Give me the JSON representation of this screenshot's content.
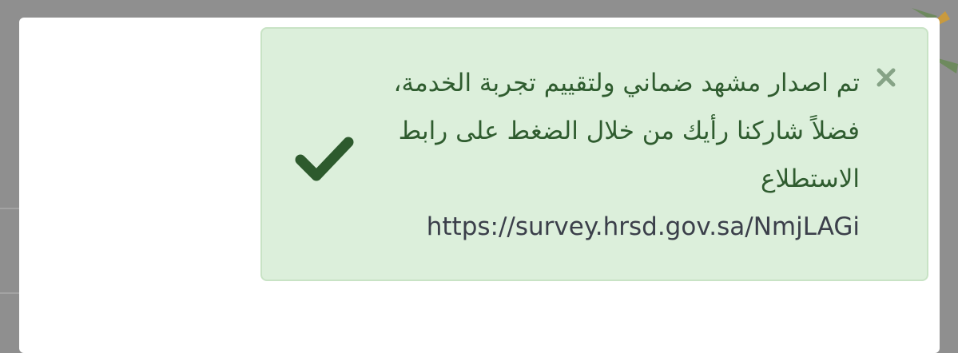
{
  "alert": {
    "status": "success",
    "message": "تم اصدار مشهد ضماني ولتقييم تجربة الخدمة، فضلاً شاركنا رأيك من خلال الضغط على رابط الاستطلاع",
    "link": "https://survey.hrsd.gov.sa/NmjLAGi",
    "close_icon": "close-icon",
    "status_icon": "checkmark-icon"
  },
  "colors": {
    "alert_background": "#dcefdb",
    "alert_border": "#c8e3c5",
    "alert_text": "#2f5c2f",
    "link_text": "#3b3f4a",
    "close_icon": "#86a386",
    "check_icon": "#2d5a2d",
    "overlay": "#8f8f8f"
  }
}
